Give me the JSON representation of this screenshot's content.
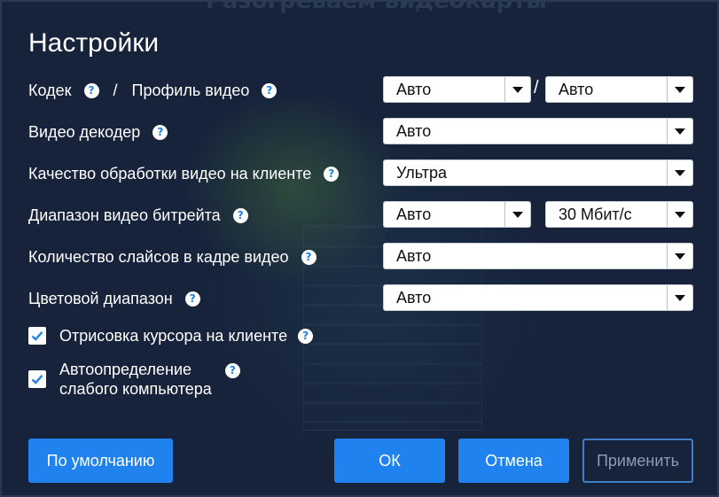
{
  "dialog": {
    "background_title": "Разогреваем видеокарты",
    "title": "Настройки"
  },
  "icons": {
    "help": "question-circle-icon",
    "dropdown": "chevron-down-icon",
    "check": "check-icon"
  },
  "colors": {
    "accent": "#1f82ef",
    "background": "#16233b",
    "text": "#ffffff"
  },
  "settings": {
    "codec": {
      "label": "Кодек",
      "separator": "/",
      "profile_label": "Профиль видео",
      "codec_value": "Авто",
      "value_separator": "/",
      "profile_value": "Авто"
    },
    "decoder": {
      "label": "Видео декодер",
      "value": "Авто"
    },
    "quality": {
      "label": "Качество обработки видео на клиенте",
      "value": "Ультра"
    },
    "bitrate": {
      "label": "Диапазон видео битрейта",
      "min_value": "Авто",
      "max_value": "30 Мбит/с"
    },
    "slices": {
      "label": "Количество слайсов в кадре видео",
      "value": "Авто"
    },
    "color_range": {
      "label": "Цветовой диапазон",
      "value": "Авто"
    }
  },
  "checkboxes": {
    "cursor": {
      "label": "Отрисовка курсора на клиенте",
      "checked": true
    },
    "weak_pc": {
      "label_line1": "Автоопределение",
      "label_line2": "слабого компьютера",
      "checked": true
    }
  },
  "buttons": {
    "default": "По умолчанию",
    "ok": "ОК",
    "cancel": "Отмена",
    "apply": "Применить"
  }
}
